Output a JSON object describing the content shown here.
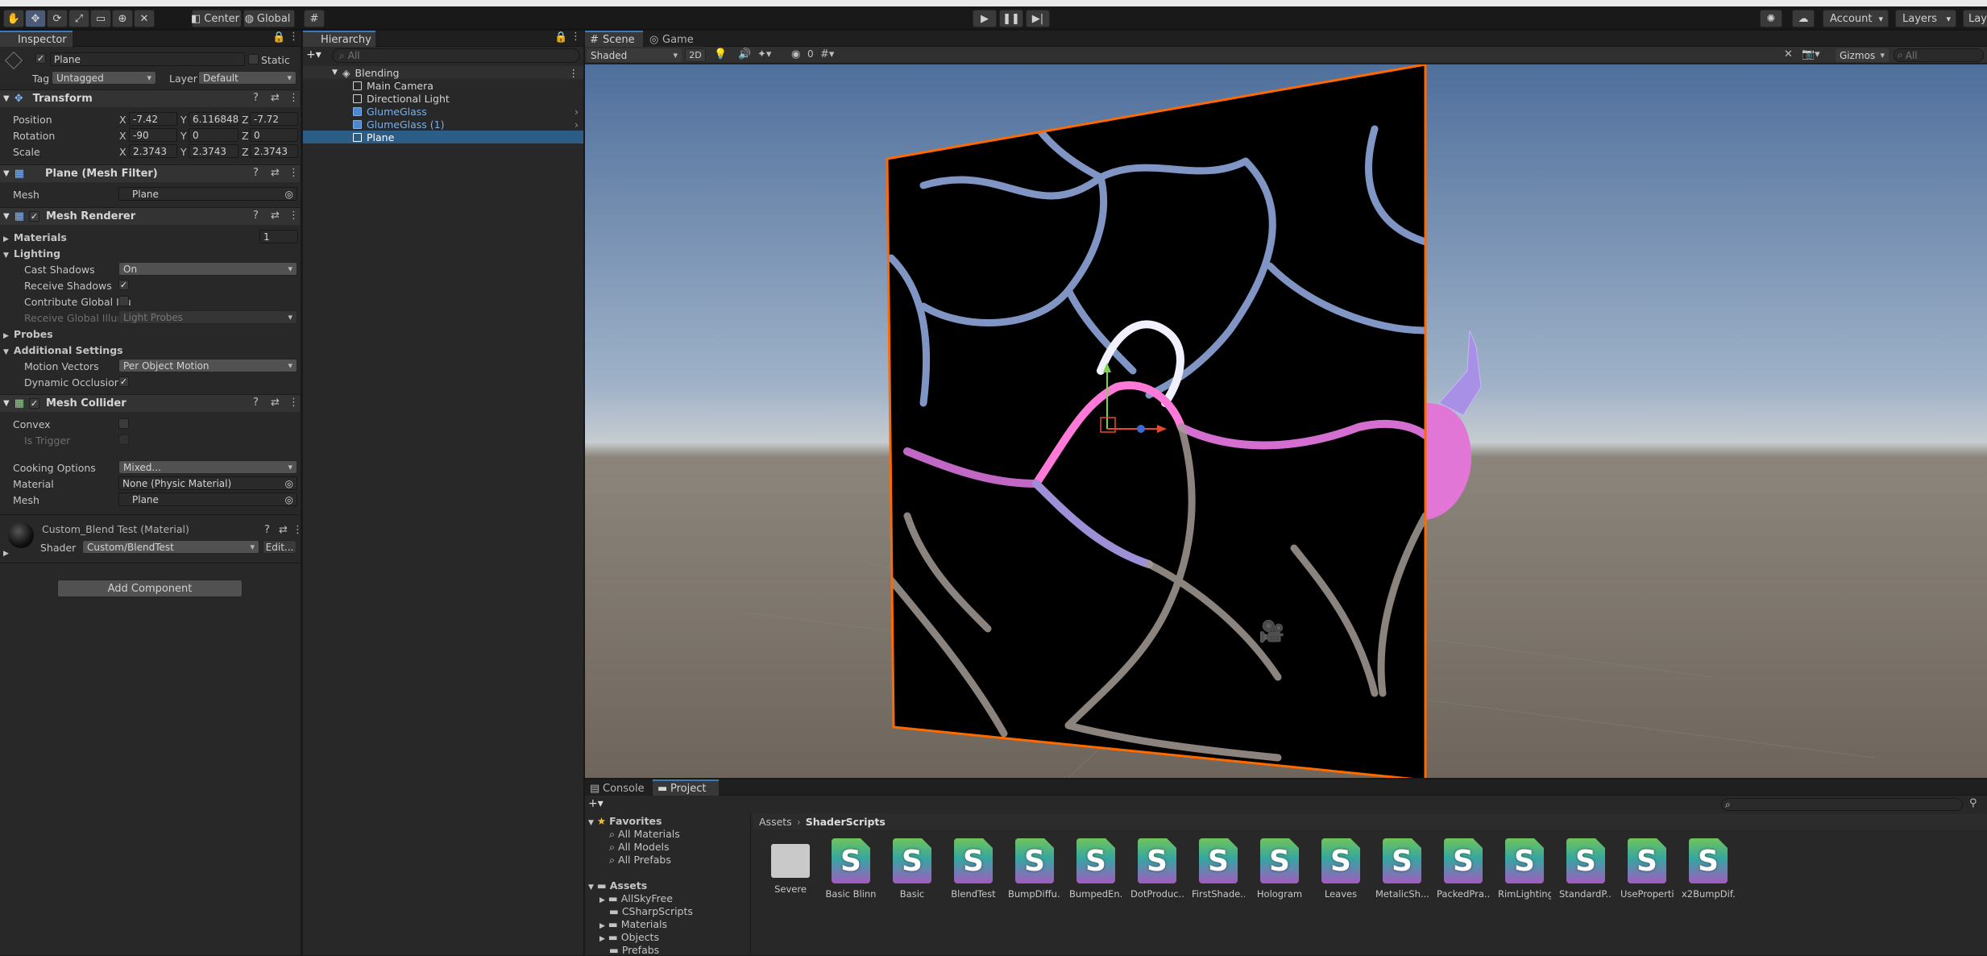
{
  "toolbar": {
    "center_label": "Center",
    "global_label": "Global",
    "account_label": "Account",
    "layers_label": "Layers",
    "layout_label": "Lay"
  },
  "inspector": {
    "tab_label": "Inspector",
    "object_name": "Plane",
    "static_label": "Static",
    "tag_label": "Tag",
    "tag_value": "Untagged",
    "layer_label": "Layer",
    "layer_value": "Default",
    "transform": {
      "title": "Transform",
      "position_label": "Position",
      "rotation_label": "Rotation",
      "scale_label": "Scale",
      "position": {
        "x": "-7.42",
        "y": "6.116848",
        "z": "-7.72"
      },
      "rotation": {
        "x": "-90",
        "y": "0",
        "z": "0"
      },
      "scale": {
        "x": "2.3743",
        "y": "2.3743",
        "z": "2.3743"
      }
    },
    "mesh_filter": {
      "title": "Plane (Mesh Filter)",
      "mesh_label": "Mesh",
      "mesh_value": "Plane"
    },
    "mesh_renderer": {
      "title": "Mesh Renderer",
      "materials_label": "Materials",
      "materials_count": "1",
      "lighting_label": "Lighting",
      "cast_shadows_label": "Cast Shadows",
      "cast_shadows_value": "On",
      "receive_shadows_label": "Receive Shadows",
      "contribute_gi_label": "Contribute Global Illu",
      "receive_gi_label": "Receive Global Illum",
      "receive_gi_value": "Light Probes",
      "probes_label": "Probes",
      "additional_label": "Additional Settings",
      "motion_vectors_label": "Motion Vectors",
      "motion_vectors_value": "Per Object Motion",
      "dynamic_occlusion_label": "Dynamic Occlusion"
    },
    "mesh_collider": {
      "title": "Mesh Collider",
      "convex_label": "Convex",
      "is_trigger_label": "Is Trigger",
      "cooking_label": "Cooking Options",
      "cooking_value": "Mixed...",
      "material_label": "Material",
      "material_value": "None (Physic Material)",
      "mesh_label": "Mesh",
      "mesh_value": "Plane"
    },
    "material": {
      "title": "Custom_Blend Test (Material)",
      "shader_label": "Shader",
      "shader_value": "Custom/BlendTest",
      "edit_label": "Edit..."
    },
    "add_component_label": "Add Component"
  },
  "hierarchy": {
    "tab_label": "Hierarchy",
    "search_placeholder": "All",
    "scene_name": "Blending",
    "items": [
      {
        "label": "Main Camera",
        "kind": "normal"
      },
      {
        "label": "Directional Light",
        "kind": "normal"
      },
      {
        "label": "GlumeGlass",
        "kind": "prefab"
      },
      {
        "label": "GlumeGlass (1)",
        "kind": "prefab"
      },
      {
        "label": "Plane",
        "kind": "selected"
      }
    ]
  },
  "scene_view": {
    "tabs": [
      "Scene",
      "Game"
    ],
    "shading_mode": "Shaded",
    "mode_2d": "2D",
    "hidden_count": "0",
    "gizmos_label": "Gizmos",
    "search_placeholder": "All"
  },
  "bottom": {
    "tabs": [
      "Console",
      "Project"
    ],
    "favorites_label": "Favorites",
    "favorites": [
      "All Materials",
      "All Models",
      "All Prefabs"
    ],
    "assets_label": "Assets",
    "asset_folders": [
      "AllSkyFree",
      "CSharpScripts",
      "Materials",
      "Objects",
      "Prefabs"
    ],
    "breadcrumb_root": "Assets",
    "breadcrumb_current": "ShaderScripts",
    "grid_items": [
      {
        "name": "Severe",
        "type": "folder"
      },
      {
        "name": "Basic Blinn",
        "type": "shader"
      },
      {
        "name": "Basic",
        "type": "shader"
      },
      {
        "name": "BlendTest",
        "type": "shader"
      },
      {
        "name": "BumpDiffu...",
        "type": "shader"
      },
      {
        "name": "BumpedEn...",
        "type": "shader"
      },
      {
        "name": "DotProduc...",
        "type": "shader"
      },
      {
        "name": "FirstShade...",
        "type": "shader"
      },
      {
        "name": "Hologram",
        "type": "shader"
      },
      {
        "name": "Leaves",
        "type": "shader"
      },
      {
        "name": "MetalicSh...",
        "type": "shader"
      },
      {
        "name": "PackedPra...",
        "type": "shader"
      },
      {
        "name": "RimLighting",
        "type": "shader"
      },
      {
        "name": "StandardP...",
        "type": "shader"
      },
      {
        "name": "UseProperti...",
        "type": "shader"
      },
      {
        "name": "x2BumpDif...",
        "type": "shader"
      }
    ]
  },
  "colors": {
    "accent": "#3a79bb",
    "selection": "#2c5d87",
    "prefab_text": "#7caee8",
    "outline": "#ff6a00"
  }
}
